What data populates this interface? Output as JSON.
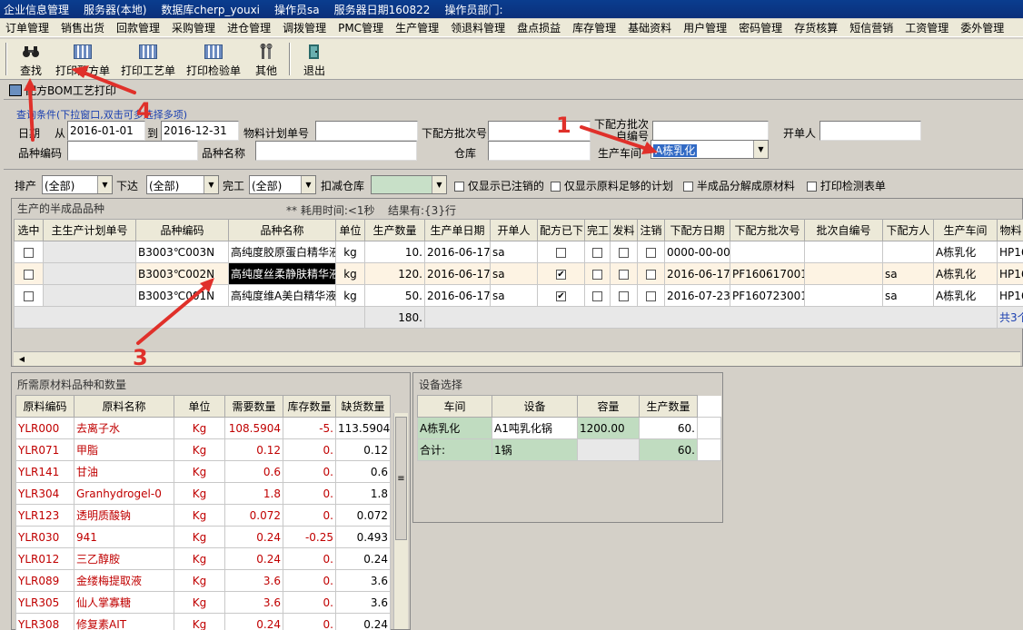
{
  "titlebar": {
    "app": "企业信息管理",
    "server": "服务器(本地)",
    "database": "数据库cherp_youxi",
    "operator": "操作员sa",
    "server_date": "服务器日期160822",
    "dept": "操作员部门:"
  },
  "menu": [
    "订单管理",
    "销售出货",
    "回款管理",
    "采购管理",
    "进仓管理",
    "调拨管理",
    "PMC管理",
    "生产管理",
    "领退料管理",
    "盘点损益",
    "库存管理",
    "基础资料",
    "用户管理",
    "密码管理",
    "存货核算",
    "短信营销",
    "工资管理",
    "委外管理"
  ],
  "toolbar": {
    "find": "查找",
    "print_formula": "打印配方单",
    "print_process": "打印工艺单",
    "print_inspect": "打印检验单",
    "other": "其他",
    "exit": "退出"
  },
  "window_title": "配方BOM工艺打印",
  "query": {
    "hint": "查询条件(下拉窗口,双击可多选择多项)",
    "date_label": "日期",
    "from_label": "从",
    "date_from": "2016-01-01",
    "to_label": "到",
    "date_to": "2016-12-31",
    "plan_no_label": "物料计划单号",
    "batch_label": "下配方批次号",
    "self_no_label": "下配方批次自编号",
    "creator_label": "开单人",
    "code_label": "品种编码",
    "name_label": "品种名称",
    "warehouse_label": "仓库",
    "workshop_label": "生产车间",
    "workshop_value": "A栋乳化"
  },
  "filters": {
    "sort_label": "排产",
    "sort_value": "(全部)",
    "issue_label": "下达",
    "issue_value": "(全部)",
    "done_label": "完工",
    "done_value": "(全部)",
    "deduct_label": "扣减仓库",
    "deduct_value": "",
    "opt1": "仅显示已注销的",
    "opt2": "仅显示原料足够的计划",
    "opt3": "半成品分解成原材料",
    "opt4": "打印检测表单"
  },
  "semi": {
    "title": "生产的半成品品种",
    "timing": "** 耗用时间:<1秒",
    "result": "结果有:{3}行",
    "headers": [
      "选中",
      "主生产计划单号",
      "品种编码",
      "品种名称",
      "单位",
      "生产数量",
      "生产单日期",
      "开单人",
      "配方已下",
      "完工",
      "发料",
      "注销",
      "下配方日期",
      "下配方批次号",
      "批次自编号",
      "下配方人",
      "生产车间",
      "物料"
    ],
    "rows": [
      {
        "code": "B3003℃003N",
        "name": "高纯度胶原蛋白精华液",
        "unit": "kg",
        "qty": "10.",
        "date": "2016-06-17",
        "creator": "sa",
        "formula": false,
        "fdate": "0000-00-00",
        "batch": "",
        "person": "",
        "workshop": "A栋乳化",
        "mat": "HP16"
      },
      {
        "code": "B3003℃002N",
        "name": "高纯度丝柔静肤精华液",
        "unit": "kg",
        "qty": "120.",
        "date": "2016-06-17",
        "creator": "sa",
        "formula": true,
        "fdate": "2016-06-17",
        "batch": "PF160617001",
        "person": "sa",
        "workshop": "A栋乳化",
        "mat": "HP16"
      },
      {
        "code": "B3003℃001N",
        "name": "高纯度维A美白精华液",
        "unit": "kg",
        "qty": "50.",
        "date": "2016-06-17",
        "creator": "sa",
        "formula": true,
        "fdate": "2016-07-23",
        "batch": "PF160723001",
        "person": "sa",
        "workshop": "A栋乳化",
        "mat": "HP16"
      }
    ],
    "total_qty": "180.",
    "total_count": "共3个"
  },
  "materials": {
    "title": "所需原材料品种和数量",
    "headers": [
      "原料编码",
      "原料名称",
      "单位",
      "需要数量",
      "库存数量",
      "缺货数量"
    ],
    "rows": [
      [
        "YLR000",
        "去离子水",
        "Kg",
        "108.5904",
        "-5.",
        "113.5904"
      ],
      [
        "YLR071",
        "甲脂",
        "Kg",
        "0.12",
        "0.",
        "0.12"
      ],
      [
        "YLR141",
        "甘油",
        "Kg",
        "0.6",
        "0.",
        "0.6"
      ],
      [
        "YLR304",
        "Granhydrogel-0",
        "Kg",
        "1.8",
        "0.",
        "1.8"
      ],
      [
        "YLR123",
        "透明质酸钠",
        "Kg",
        "0.072",
        "0.",
        "0.072"
      ],
      [
        "YLR030",
        "941",
        "Kg",
        "0.24",
        "-0.25",
        "0.493"
      ],
      [
        "YLR012",
        "三乙醇胺",
        "Kg",
        "0.24",
        "0.",
        "0.24"
      ],
      [
        "YLR089",
        "金缕梅提取液",
        "Kg",
        "3.6",
        "0.",
        "3.6"
      ],
      [
        "YLR305",
        "仙人掌寡糖",
        "Kg",
        "3.6",
        "0.",
        "3.6"
      ],
      [
        "YLR308",
        "修复素AIT",
        "Kg",
        "0.24",
        "0.",
        "0.24"
      ]
    ]
  },
  "equipment": {
    "title": "设备选择",
    "headers": [
      "车间",
      "设备",
      "容量",
      "生产数量"
    ],
    "row": [
      "A栋乳化",
      "A1吨乳化锅",
      "1200.00",
      "60."
    ],
    "total": [
      "合计:",
      "1锅",
      "",
      "60."
    ]
  },
  "annotations": [
    "1",
    "3",
    "4"
  ]
}
